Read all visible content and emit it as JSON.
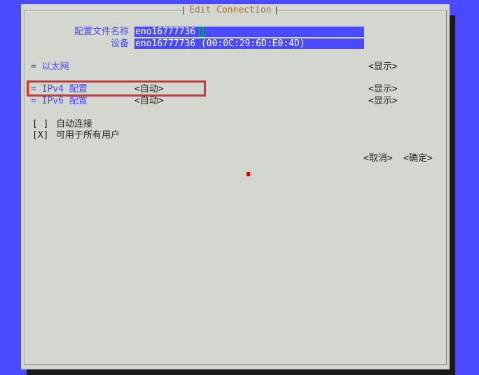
{
  "window": {
    "title": "Edit Connection"
  },
  "profile": {
    "name_label": "配置文件名称",
    "name_value": "eno16777736",
    "device_label": "设备",
    "device_value": "eno16777736 (00:0C:29:6D:E0:4D)"
  },
  "ethernet": {
    "label": "= 以太网",
    "show_button": "<显示>"
  },
  "ipv4": {
    "label": "= IPv4 配置",
    "mode": "<自动>",
    "show_button": "<显示>"
  },
  "ipv6": {
    "label": "= IPv6 配置",
    "mode": "<自动>",
    "show_button": "<显示>"
  },
  "options": {
    "autoconnect_box": "[ ]",
    "autoconnect_label": "自动连接",
    "all_users_box": "[X]",
    "all_users_label": "可用于所有用户"
  },
  "actions": {
    "cancel": "<取消>",
    "ok": "<确定>"
  },
  "colors": {
    "background": "#4a4aff",
    "dialog": "#d3d7cf",
    "title": "#b0702c",
    "highlight": "#e03030"
  }
}
